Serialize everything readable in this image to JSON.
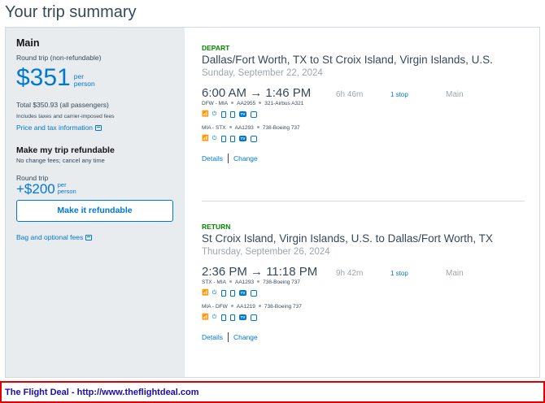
{
  "page": {
    "title": "Your trip summary"
  },
  "summary": {
    "cabin": "Main",
    "trip_type": "Round trip (non-refundable)",
    "price": "$351",
    "per_line1": "per",
    "per_line2": "person",
    "total": "Total $350.93 (all passengers)",
    "taxes_note": "Includes taxes and carrier-imposed fees",
    "taxes_link": "Price and tax information",
    "refund_title": "Make my trip refundable",
    "refund_sub": "No change fees; cancel any time",
    "refund_trip": "Round trip",
    "refund_price": "+$200",
    "refund_per1": "per",
    "refund_per2": "person",
    "refund_button": "Make it refundable",
    "bag_link": "Bag and optional fees"
  },
  "depart": {
    "label": "DEPART",
    "route": "Dallas/Fort Worth, TX to St Croix Island, Virgin Islands, U.S.",
    "date": "Sunday, September 22, 2024",
    "times": "6:00 AM → 1:46 PM",
    "duration": "6h 46m",
    "stops": "1 stop",
    "cabin": "Main",
    "legs": [
      {
        "route": "DFW - MIA",
        "flight": "AA2955",
        "aircraft": "321-Airbus A321"
      },
      {
        "route": "MIA - STX",
        "flight": "AA1293",
        "aircraft": "738-Boeing 737"
      }
    ],
    "details": "Details",
    "change": "Change"
  },
  "return": {
    "label": "RETURN",
    "route": "St Croix Island, Virgin Islands, U.S. to Dallas/Fort Worth, TX",
    "date": "Thursday, September 26, 2024",
    "times": "2:36 PM → 11:18 PM",
    "duration": "9h 42m",
    "stops": "1 stop",
    "cabin": "Main",
    "legs": [
      {
        "route": "STX - MIA",
        "flight": "AA1293",
        "aircraft": "738-Boeing 737"
      },
      {
        "route": "MIA - DFW",
        "flight": "AA1219",
        "aircraft": "738-Boeing 737"
      }
    ],
    "details": "Details",
    "change": "Change"
  },
  "amenities": [
    "wifi-icon",
    "power-icon",
    "usb-icon",
    "phone-icon",
    "tv-icon",
    "entertainment-icon"
  ],
  "footer": {
    "text": "The Flight Deal - http://www.theflightdeal.com"
  },
  "colors": {
    "accent": "#0078d2",
    "depart_green": "#008700",
    "footer_border": "#e00000",
    "footer_link": "#1a0dab"
  }
}
